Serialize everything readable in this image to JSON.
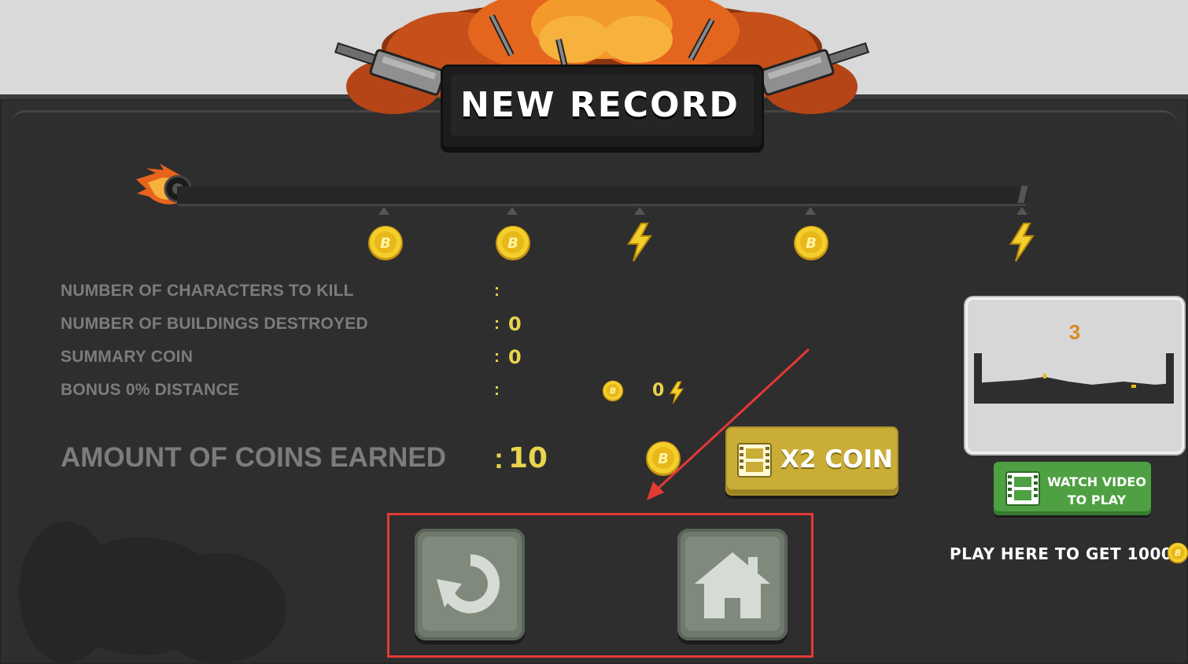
{
  "header": {
    "title": "NEW RECORD"
  },
  "progress": {
    "rewards": [
      {
        "type": "coin"
      },
      {
        "type": "coin"
      },
      {
        "type": "bolt"
      },
      {
        "type": "coin"
      },
      {
        "type": "bolt"
      }
    ]
  },
  "stats": [
    {
      "label": "NUMBER OF CHARACTERS TO KILL",
      "colon": ":",
      "value": ""
    },
    {
      "label": "NUMBER OF BUILDINGS DESTROYED",
      "colon": ":",
      "value": "0"
    },
    {
      "label": "SUMMARY COIN",
      "colon": ":",
      "value": "0"
    },
    {
      "label": "BONUS 0% DISTANCE",
      "colon": ":",
      "value": ""
    }
  ],
  "bonus_bolt_value": "0",
  "earned": {
    "label": "AMOUNT OF COINS EARNED",
    "colon": ":",
    "value": "10"
  },
  "buttons": {
    "x2_coin": "X2 COIN",
    "watch_video_line1": "WATCH VIDEO",
    "watch_video_line2": "TO PLAY",
    "play_here": "PLAY HERE TO GET 1000"
  },
  "preview": {
    "count": "3"
  },
  "icons": {
    "coin": "coin-icon",
    "bolt": "lightning-icon",
    "replay": "replay-icon",
    "home": "home-icon",
    "film": "film-icon"
  },
  "colors": {
    "panel": "#2f2f2f",
    "accent_yellow": "#e8d44d",
    "label_gray": "#7c7c7c",
    "x2_button": "#c9ad37",
    "watch_button": "#4ea043",
    "highlight": "#e53935"
  }
}
